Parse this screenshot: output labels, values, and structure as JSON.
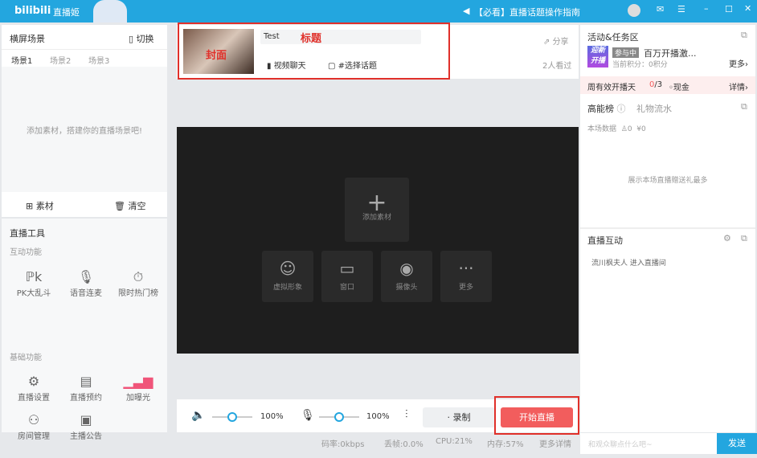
{
  "titlebar": {
    "logo": "bilibili",
    "app_name": "直播姬",
    "notice": "【必看】直播话题操作指南"
  },
  "left": {
    "scene_title": "横屏场景",
    "switch_label": "切换",
    "scenes": [
      "场景1",
      "场景2",
      "场景3"
    ],
    "empty_hint": "添加素材，搭建你的直播场景吧!",
    "add_material": "素材",
    "clear": "清空",
    "tools_title": "直播工具",
    "interactive_label": "互动功能",
    "interactive": [
      "PK大乱斗",
      "语音连麦",
      "限时热门榜"
    ],
    "basic_label": "基础功能",
    "basic": [
      "直播设置",
      "直播预约",
      "加曝光",
      "房间管理",
      "主播公告"
    ]
  },
  "header": {
    "cover_label": "封面",
    "title_value": "Test",
    "title_annotation": "标题",
    "category": "视频聊天",
    "topic": "#选择话题",
    "share": "分享",
    "viewers": "2人看过"
  },
  "preview": {
    "add_source": "添加素材",
    "sources": [
      "虚拟形象",
      "窗口",
      "摄像头",
      "更多"
    ]
  },
  "controls": {
    "speaker_volume": "100%",
    "mic_volume": "100%",
    "record": "录制",
    "start_live": "开始直播"
  },
  "status": {
    "bitrate": "码率:0kbps",
    "dropped": "丢帧:0.0%",
    "cpu": "CPU:21%",
    "memory": "内存:57%",
    "more": "更多详情"
  },
  "right": {
    "activity_title": "活动&任务区",
    "badge_lines": [
      "迎新",
      "开播"
    ],
    "status_tag": "参与中",
    "activity_name": "百万开播激...",
    "points": "当前积分：0积分",
    "more": "更多",
    "weekly_label": "周有效开播天",
    "weekly_progress": "0",
    "weekly_total": "/3",
    "cash": "现金",
    "details": "详情",
    "rank_tab": "高能榜",
    "gift_tab": "礼物流水",
    "session_label": "本场数据",
    "people": "0",
    "money": "¥0",
    "rank_empty": "展示本场直播赠送礼最多",
    "interact_title": "直播互动",
    "interact_msg": "流川枫夫人 进入直播间",
    "chat_placeholder": "和观众聊点什么吧~",
    "send": "发送"
  },
  "colors": {
    "brand": "#23a6df",
    "start": "#f25d5d",
    "annotation": "#e0302a"
  }
}
